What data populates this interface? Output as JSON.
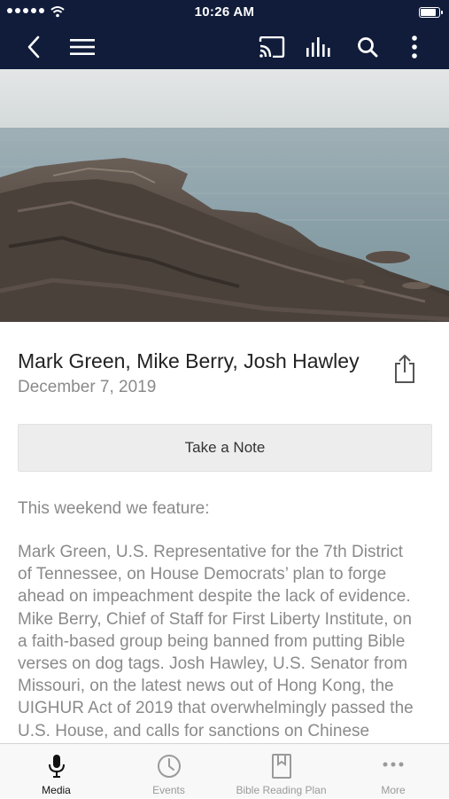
{
  "status_bar": {
    "time": "10:26 AM"
  },
  "toolbar": {
    "icons": [
      "back-icon",
      "menu-icon",
      "cast-icon",
      "audio-bars-icon",
      "search-icon",
      "more-vertical-icon"
    ]
  },
  "hero": {
    "alt_icon": "coastline-photo"
  },
  "sermon": {
    "title": "Mark Green, Mike Berry, Josh Hawley",
    "date": "December 7, 2019"
  },
  "take_note_label": "Take a Note",
  "description": {
    "intro": "This weekend we feature:",
    "lines": [
      "Mark Green, U.S. Representative for the 7th District",
      "of Tennessee, on House Democrats’ plan to forge",
      "ahead on impeachment despite the lack of evidence.",
      "Mike Berry, Chief of Staff for First Liberty Institute, on",
      "a faith-based group being banned from putting Bible",
      "verses on dog tags. Josh Hawley, U.S. Senator from",
      "Missouri, on the latest news out of Hong Kong, the",
      "UIGHUR Act of 2019 that overwhelmingly passed the",
      "U.S. House, and calls for sanctions on Chinese"
    ]
  },
  "tabs": [
    {
      "label": "Media",
      "icon": "microphone-icon",
      "active": true
    },
    {
      "label": "Events",
      "icon": "clock-icon",
      "active": false
    },
    {
      "label": "Bible Reading Plan",
      "icon": "bookmark-page-icon",
      "active": false
    },
    {
      "label": "More",
      "icon": "ellipsis-icon",
      "active": false
    }
  ],
  "colors": {
    "nav_bg": "#101c3a",
    "text_gray": "#8a8a8a",
    "button_bg": "#ededed"
  }
}
